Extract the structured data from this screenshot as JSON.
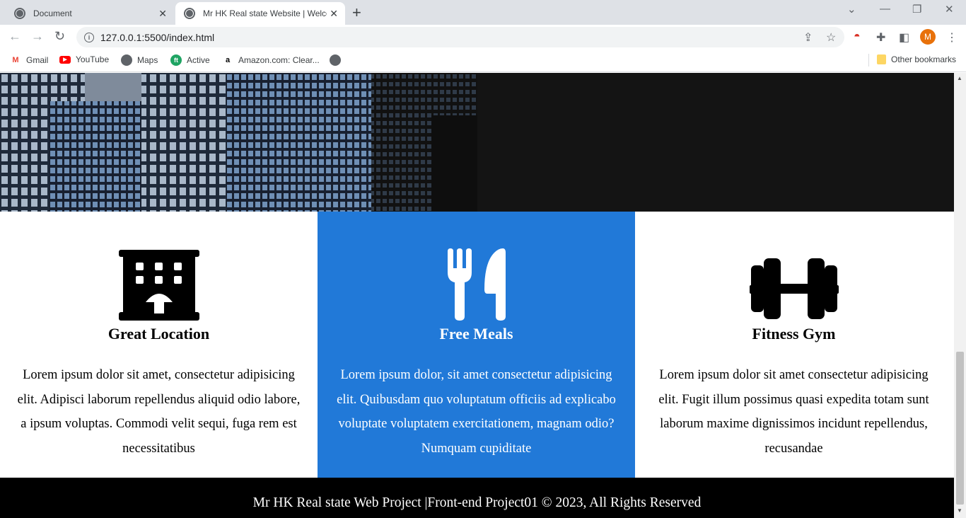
{
  "browser": {
    "tabs": [
      {
        "title": "Document",
        "close": "✕"
      },
      {
        "title": "Mr HK Real state Website | Welco",
        "close": "✕"
      }
    ],
    "new_tab": "+",
    "url": "127.0.0.1:5500/index.html",
    "profile_initial": "M",
    "bookmarks": [
      {
        "label": "Gmail"
      },
      {
        "label": "YouTube"
      },
      {
        "label": "Maps"
      },
      {
        "label": "Active"
      },
      {
        "label": "Amazon.com: Clear..."
      }
    ],
    "other_bookmarks": "Other bookmarks"
  },
  "features": [
    {
      "icon": "building-icon",
      "title": "Great Location",
      "text": "Lorem ipsum dolor sit amet, consectetur adipisicing elit. Adipisci laborum repellendus aliquid odio labore, a ipsum voluptas. Commodi velit sequi, fuga rem est necessitatibus"
    },
    {
      "icon": "utensils-icon",
      "title": "Free Meals",
      "text": "Lorem ipsum dolor, sit amet consectetur adipisicing elit. Quibusdam quo voluptatum officiis ad explicabo voluptate voluptatem exercitationem, magnam odio? Numquam cupiditate"
    },
    {
      "icon": "dumbbell-icon",
      "title": "Fitness Gym",
      "text": "Lorem ipsum dolor sit amet consectetur adipisicing elit. Fugit illum possimus quasi expedita totam sunt laborum maxime dignissimos incidunt repellendus, recusandae"
    }
  ],
  "footer": {
    "text": "Mr HK Real state Web Project |Front-end Project01 © 2023, All Rights Reserved"
  },
  "colors": {
    "accent_blue": "#2179d8",
    "footer_bg": "#000000",
    "hero_dark": "#141414"
  }
}
